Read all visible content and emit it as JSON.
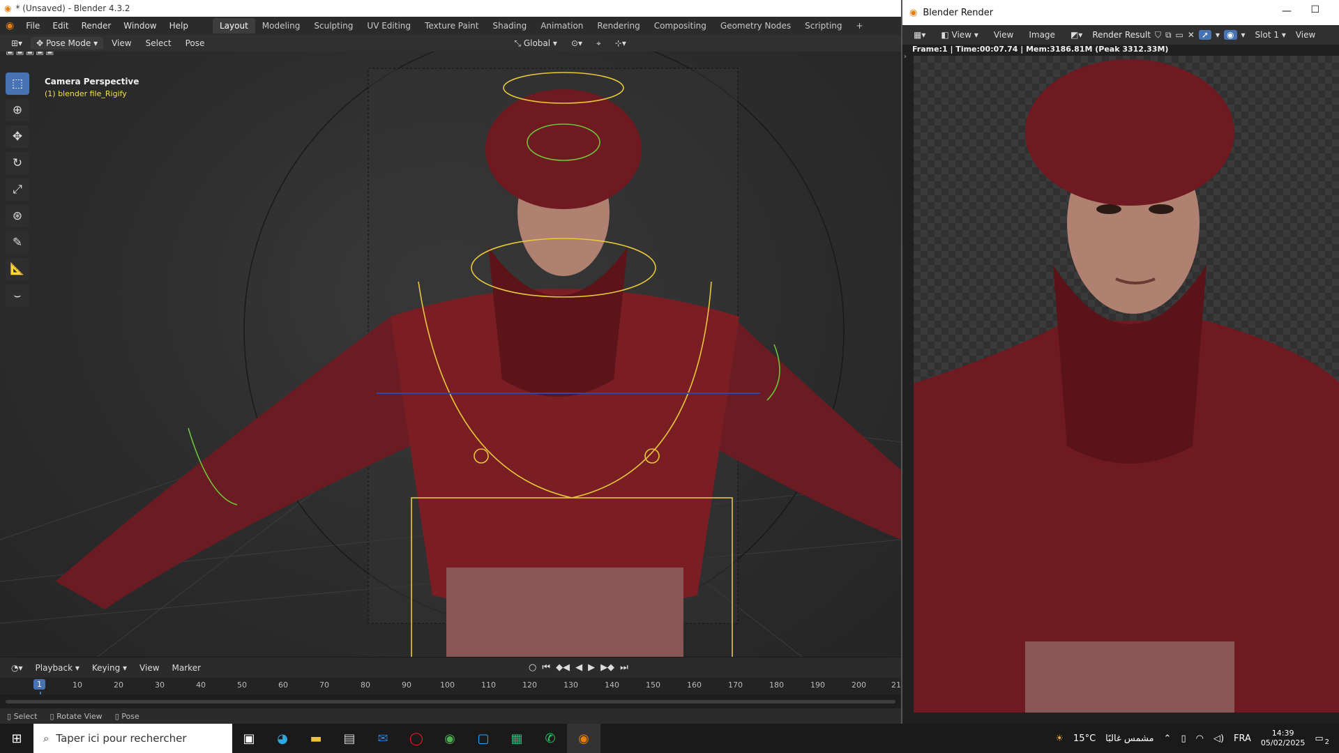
{
  "window": {
    "title": "* (Unsaved) - Blender 4.3.2"
  },
  "menu": {
    "items": [
      "File",
      "Edit",
      "Render",
      "Window",
      "Help"
    ]
  },
  "workspaces": {
    "tabs": [
      "Layout",
      "Modeling",
      "Sculpting",
      "UV Editing",
      "Texture Paint",
      "Shading",
      "Animation",
      "Rendering",
      "Compositing",
      "Geometry Nodes",
      "Scripting"
    ],
    "active": "Layout",
    "add": "+"
  },
  "viewport_header": {
    "mode": "Pose Mode",
    "menus": [
      "View",
      "Select",
      "Pose"
    ],
    "orientation": "Global"
  },
  "viewport": {
    "camera_label": "Camera Perspective",
    "object_label": "(1) blender file_Rigify"
  },
  "timeline": {
    "menus": [
      "Playback",
      "Keying",
      "View",
      "Marker"
    ],
    "current_frame": "1",
    "ticks": [
      "10",
      "20",
      "30",
      "40",
      "50",
      "60",
      "70",
      "80",
      "90",
      "100",
      "110",
      "120",
      "130",
      "140",
      "150",
      "160",
      "170",
      "180",
      "190",
      "200",
      "21"
    ]
  },
  "status": {
    "items": [
      "Select",
      "Rotate View",
      "Pose"
    ]
  },
  "render": {
    "title": "Blender Render",
    "menus": [
      "View",
      "View",
      "Image"
    ],
    "result": "Render Result",
    "slot": "Slot 1",
    "view_cut": "View",
    "info": "Frame:1 | Time:00:07.74 | Mem:3186.81M (Peak 3312.33M)"
  },
  "taskbar": {
    "search_placeholder": "Taper ici pour rechercher",
    "weather_temp": "15°C",
    "weather_text": "مشمس غالبًا",
    "lang": "FRA",
    "time": "14:39",
    "date": "05/02/2025",
    "notif_count": "2"
  },
  "colors": {
    "accent": "#4772b3",
    "rig_yellow": "#e8c83a",
    "rig_green": "#6fc43a",
    "cloth_red": "#7a1e24"
  }
}
